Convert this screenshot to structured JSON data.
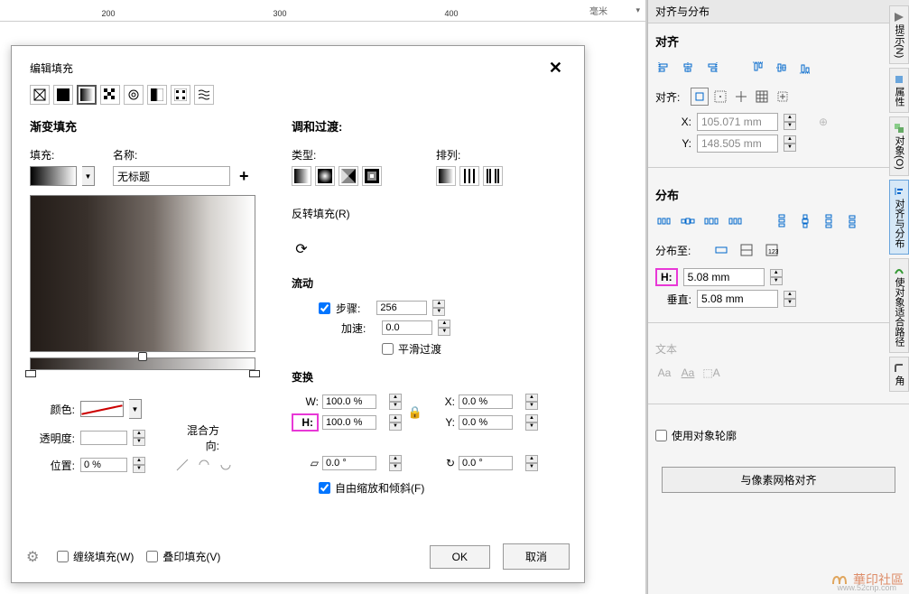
{
  "docker": {
    "title": "对齐与分布",
    "h_align": "对齐",
    "align_label": "对齐:",
    "x_label": "X:",
    "y_label": "Y:",
    "x_value": "105.071 mm",
    "y_value": "148.505 mm",
    "h_distribute": "分布",
    "dist_to_label": "分布至:",
    "h_field_label": "H:",
    "h_value": "5.08 mm",
    "v_field_label": "垂直:",
    "v_value": "5.08 mm",
    "text_section": "文本",
    "use_outline_label": "使用对象轮廓",
    "pixel_grid_btn": "与像素网格对齐"
  },
  "tabs": {
    "hints": "提示(N)",
    "props": "属性",
    "objects": "对象(O)",
    "align": "对齐与分布",
    "fit": "使对象适合路径",
    "corner": "角"
  },
  "dialog": {
    "title": "编辑填充",
    "left_h": "渐变填充",
    "fill_label": "填充:",
    "name_label": "名称:",
    "name_value": "无标题",
    "color_label": "颜色:",
    "opacity_label": "透明度:",
    "position_label": "位置:",
    "position_value": "0 %",
    "blend_label": "混合方向:",
    "right_h": "调和过渡:",
    "type_label": "类型:",
    "arrangement_label": "排列:",
    "reverse_label": "反转填充(R)",
    "flow_h": "流动",
    "steps_label": "步骤:",
    "steps_value": "256",
    "accel_label": "加速:",
    "accel_value": "0.0",
    "smooth_label": "平滑过渡",
    "transform_h": "变换",
    "w_label": "W:",
    "w_value": "100.0 %",
    "h_label": "H:",
    "h_value": "100.0 %",
    "x_label": "X:",
    "x_value": "0.0 %",
    "y_label": "Y:",
    "y_value": "0.0 %",
    "skew_value": "0.0 °",
    "rot_value": "0.0 °",
    "free_scale_label": "自由缩放和倾斜(F)",
    "winding_label": "缠绕填充(W)",
    "overprint_label": "叠印填充(V)",
    "ok": "OK",
    "cancel": "取消"
  },
  "ruler": {
    "unit": "毫米"
  },
  "watermark": {
    "text": "華印社區",
    "sub": "www.52cnp.com"
  }
}
